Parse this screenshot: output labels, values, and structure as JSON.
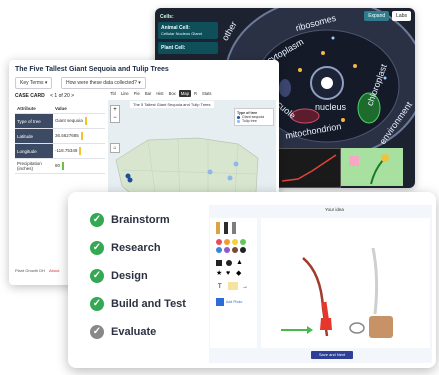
{
  "cell": {
    "section_title": "Cells:",
    "sidebar": [
      {
        "title": "Animal Cell:",
        "sub": "Cellular Nucleus Gland"
      },
      {
        "title": "Plant Cell:",
        "sub": ""
      }
    ],
    "buttons": [
      "Expand",
      "Labs"
    ],
    "labels": {
      "other": "other",
      "ribosomes": "ribosomes",
      "cytoplasm": "cytoplasm",
      "vacuole": "vacuole",
      "nucleus": "nucleus",
      "mitochondrion": "mitochondrion",
      "chloroplast": "chloroplast",
      "environment": "environment"
    }
  },
  "map": {
    "title": "The Five Tallest Giant Sequoia and Tulip Trees",
    "dropdown_key_terms": "Key Terms ▾",
    "dropdown_question": "How were these data collected? ▾",
    "case_card": "CASE CARD",
    "case_count": "< 1 of 20 >",
    "col_attribute": "Attribute",
    "col_value": "Value",
    "rows": [
      {
        "attr": "Type of tree",
        "value": "Giant sequoia"
      },
      {
        "attr": "Latitude",
        "value": "36.5627685"
      },
      {
        "attr": "Longitude",
        "value": "-118.75349"
      },
      {
        "attr": "Precipitation (inches)",
        "value": "80"
      }
    ],
    "footer": "Plant Growth DH",
    "footer_link": "About",
    "toolbar": [
      "Tbl",
      "Line",
      "Pie",
      "Bar",
      "Hist",
      "Box",
      "Map",
      "R",
      "Stats"
    ],
    "toolbar_active": "Map",
    "map_subtitle": "The 5 Tallest Giant Sequoia and Tulip Trees",
    "legend_title": "Type of tree",
    "legend": [
      {
        "name": "Giant sequoia",
        "color": "#1f4e99"
      },
      {
        "name": "Tulip tree",
        "color": "#8fb8e8"
      }
    ]
  },
  "edp": {
    "steps": [
      {
        "label": "Brainstorm",
        "done": true
      },
      {
        "label": "Research",
        "done": true
      },
      {
        "label": "Design",
        "done": true
      },
      {
        "label": "Build and Test",
        "done": true
      },
      {
        "label": "Evaluate",
        "done": false
      }
    ],
    "panel_title": "Your idea",
    "submit": "Save and Next",
    "palette_label": "Add Photo"
  }
}
